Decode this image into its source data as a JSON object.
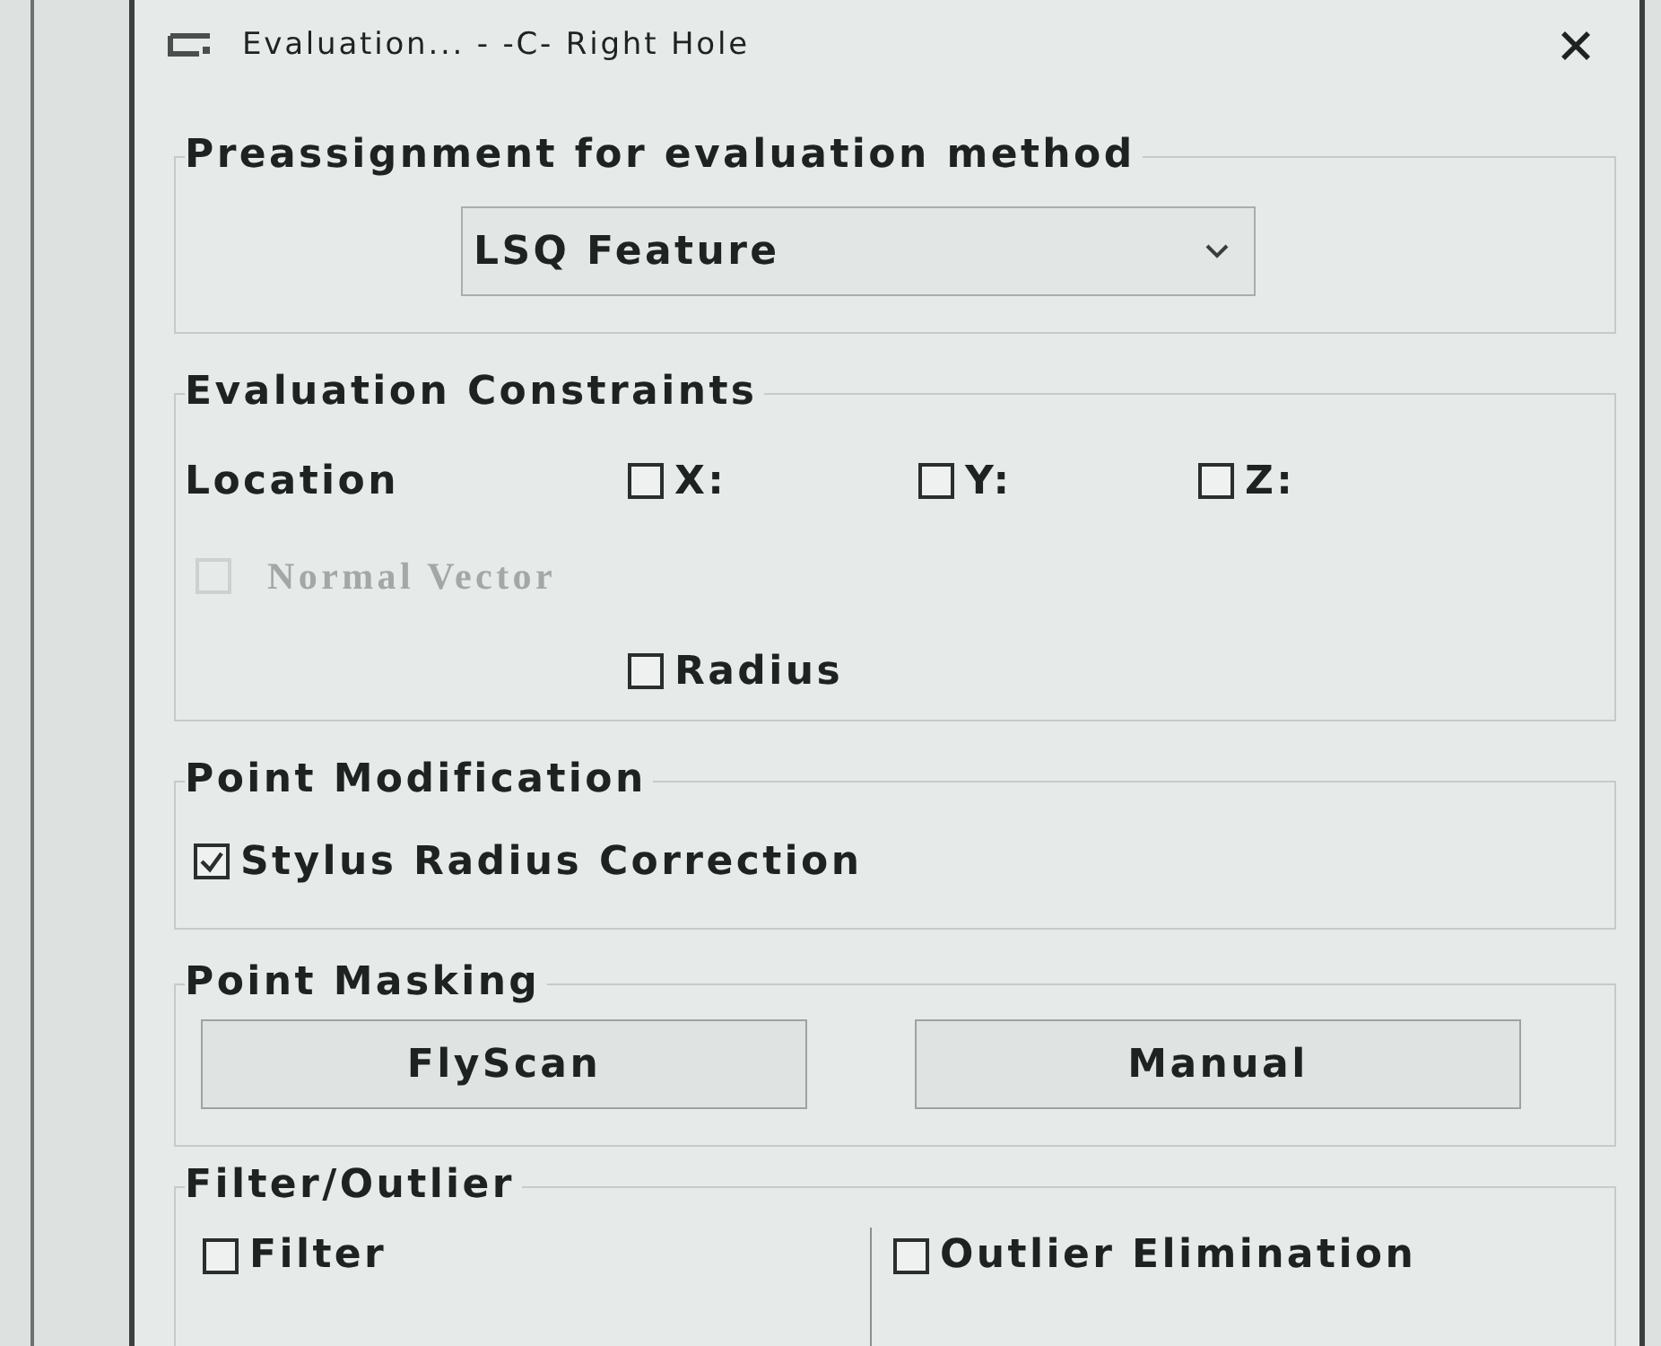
{
  "window": {
    "title": "Evaluation... - -C- Right Hole"
  },
  "preassignment": {
    "label": "Preassignment for evaluation method",
    "method": {
      "value": "LSQ Feature"
    }
  },
  "constraints": {
    "label": "Evaluation Constraints",
    "location_label": "Location",
    "axes": [
      {
        "label": "X:",
        "checked": false
      },
      {
        "label": "Y:",
        "checked": false
      },
      {
        "label": "Z:",
        "checked": false
      }
    ],
    "normal_vector": {
      "label": "Normal Vector",
      "checked": false,
      "disabled": true
    },
    "radius": {
      "label": "Radius",
      "checked": false
    }
  },
  "point_modification": {
    "label": "Point Modification",
    "options": [
      {
        "label": "Stylus Radius Correction",
        "checked": true
      }
    ]
  },
  "point_masking": {
    "label": "Point Masking",
    "buttons": [
      "FlyScan",
      "Manual"
    ]
  },
  "filter_outlier": {
    "label": "Filter/Outlier",
    "options": [
      {
        "label": "Filter",
        "checked": false
      },
      {
        "label": "Outlier Elimination",
        "checked": false
      }
    ]
  }
}
